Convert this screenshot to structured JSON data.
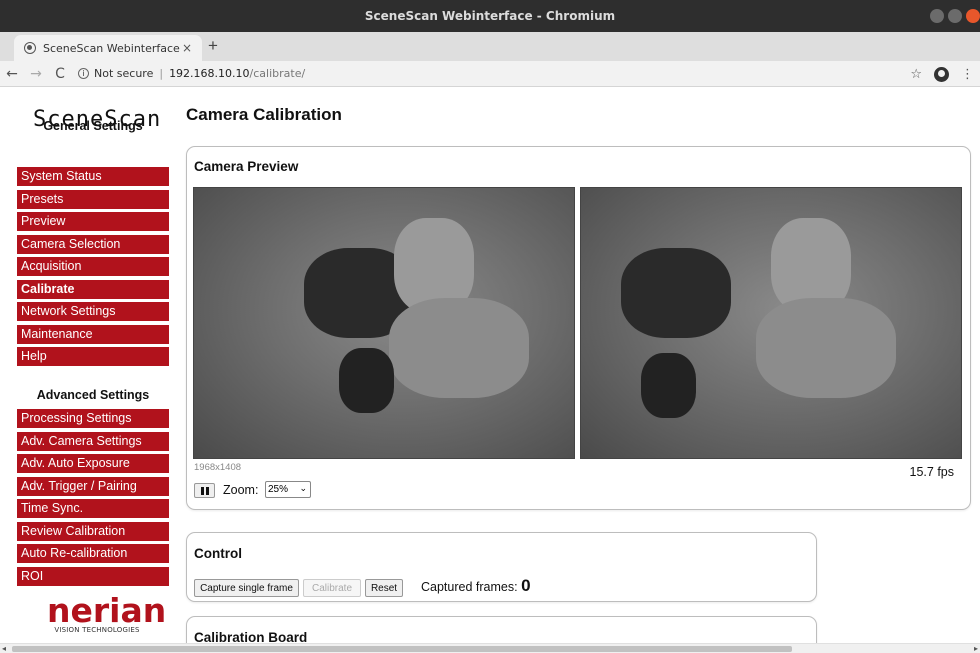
{
  "window": {
    "title": "SceneScan Webinterface - Chromium"
  },
  "browser": {
    "tab_title": "SceneScan Webinterface",
    "tab_close": "×",
    "new_tab": "+",
    "security_label": "Not secure",
    "url_host": "192.168.10.10",
    "url_path": "/calibrate/"
  },
  "sidebar": {
    "brand": "SceneScan",
    "general_title": "General Settings",
    "general_items": [
      {
        "label": "System Status"
      },
      {
        "label": "Presets"
      },
      {
        "label": "Preview"
      },
      {
        "label": "Camera Selection"
      },
      {
        "label": "Acquisition"
      },
      {
        "label": "Calibrate",
        "active": true
      },
      {
        "label": "Network Settings"
      },
      {
        "label": "Maintenance"
      },
      {
        "label": "Help"
      }
    ],
    "advanced_title": "Advanced Settings",
    "advanced_items": [
      {
        "label": "Processing Settings"
      },
      {
        "label": "Adv. Camera Settings"
      },
      {
        "label": "Adv. Auto Exposure"
      },
      {
        "label": "Adv. Trigger / Pairing"
      },
      {
        "label": "Time Sync."
      },
      {
        "label": "Review Calibration"
      },
      {
        "label": "Auto Re-calibration"
      },
      {
        "label": "ROI"
      }
    ],
    "logo_word": "nerian",
    "logo_sub": "VISION TECHNOLOGIES",
    "menu_color": "#b1121c"
  },
  "main": {
    "title": "Camera Calibration",
    "preview": {
      "title": "Camera Preview",
      "resolution": "1968x1408",
      "fps": "15.7 fps",
      "zoom_label": "Zoom:",
      "zoom_value": "25%"
    },
    "control": {
      "title": "Control",
      "capture_button": "Capture single frame",
      "calibrate_button": "Calibrate",
      "reset_button": "Reset",
      "captured_label": "Captured frames:",
      "captured_count": "0"
    },
    "board": {
      "title": "Calibration Board"
    }
  }
}
